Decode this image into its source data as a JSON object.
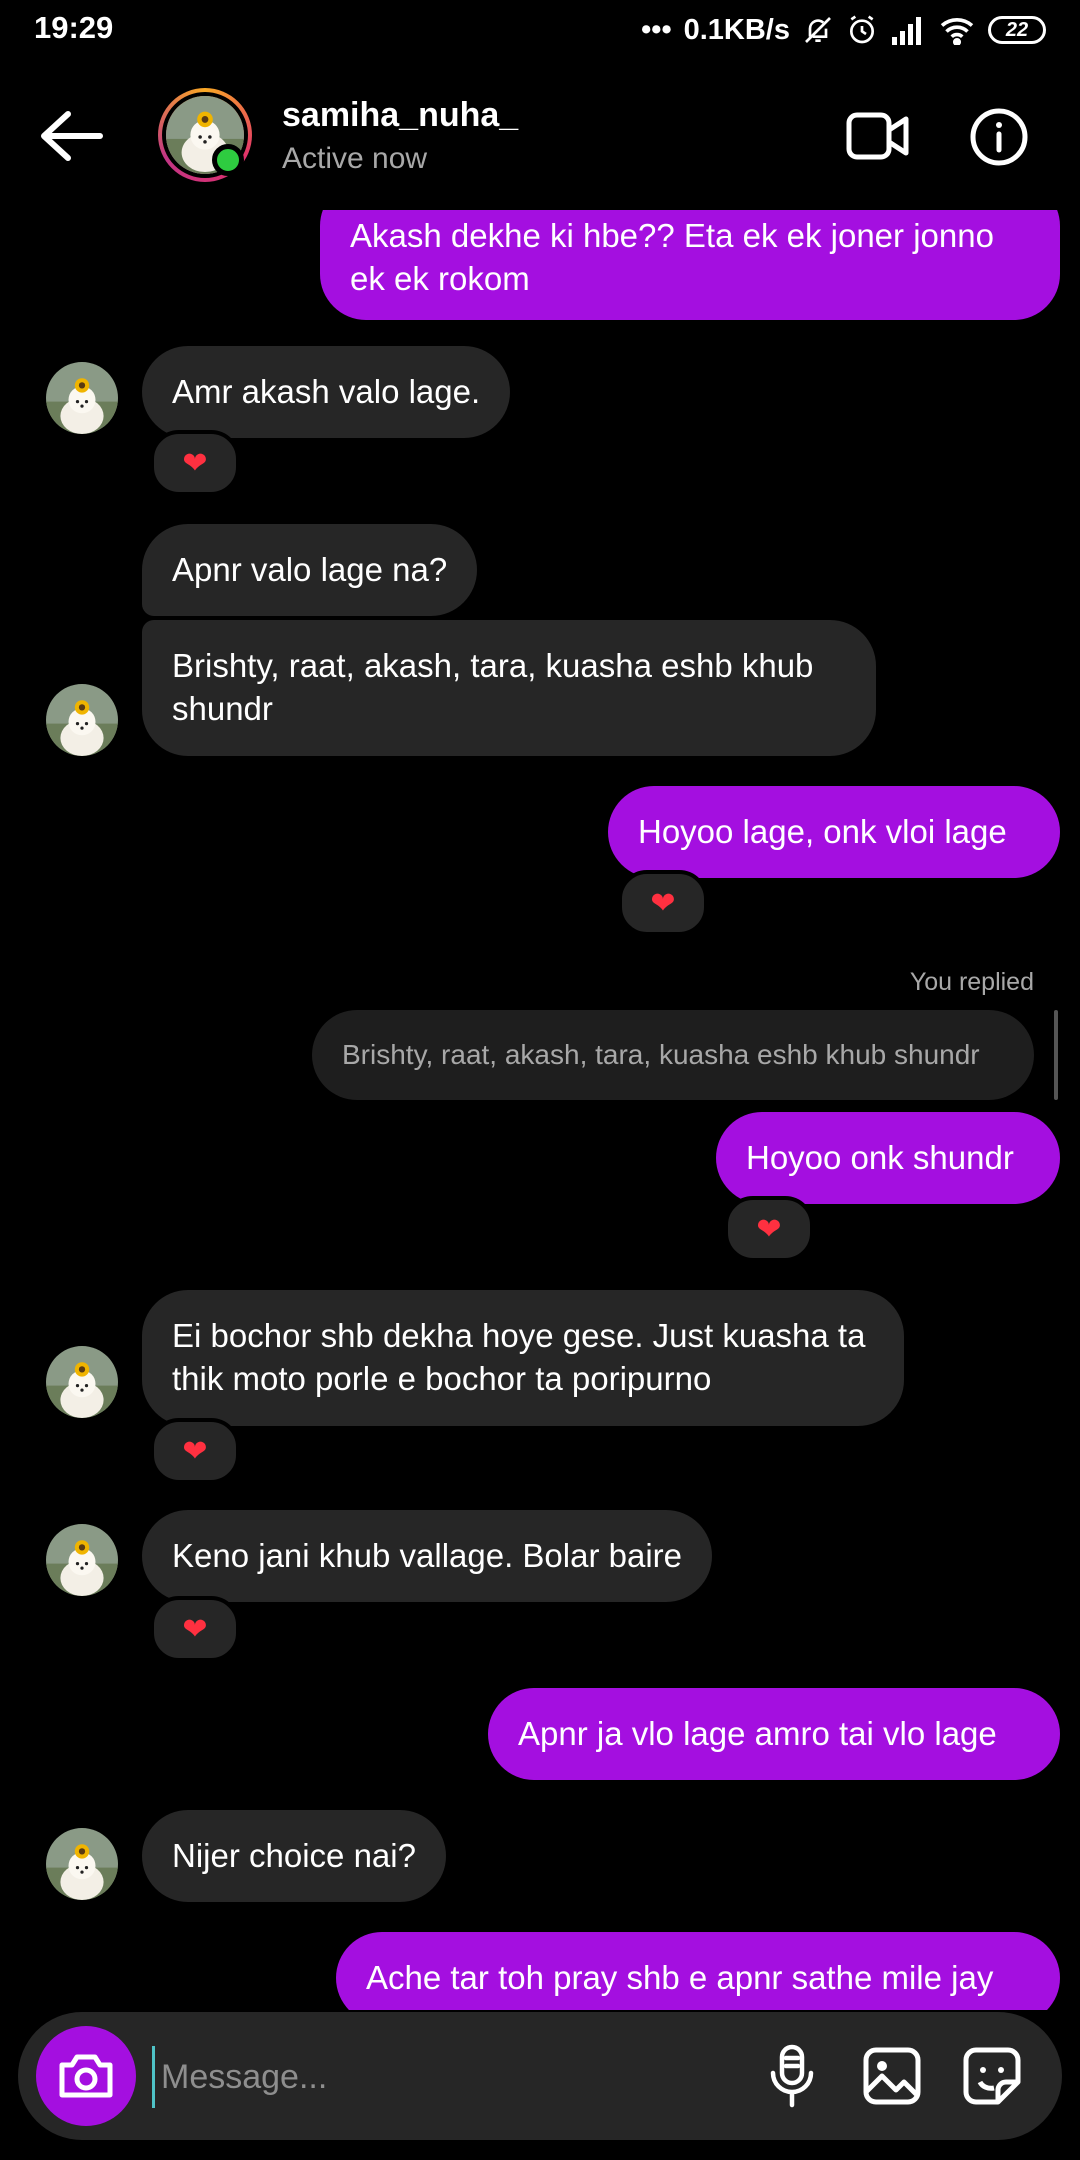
{
  "status_bar": {
    "time": "19:29",
    "network_speed": "0.1KB/s",
    "battery": "22"
  },
  "header": {
    "username": "samiha_nuha_",
    "status": "Active now"
  },
  "messages": [
    {
      "side": "out",
      "text": "Akash dekhe ki hbe?? Eta ek ek joner jonno ek ek rokom"
    },
    {
      "side": "in",
      "text": "Amr akash valo lage.",
      "reaction": "❤"
    },
    {
      "side": "in",
      "text": "Apnr valo lage na?"
    },
    {
      "side": "in",
      "text": "Brishty, raat, akash, tara, kuasha eshb khub shundr"
    },
    {
      "side": "out",
      "text": "Hoyoo lage, onk vloi lage",
      "reaction": "❤"
    },
    {
      "side": "out",
      "reply_label": "You replied",
      "quoted": "Brishty, raat, akash, tara, kuasha eshb khub shundr",
      "text": "Hoyoo onk shundr",
      "reaction": "❤"
    },
    {
      "side": "in",
      "text": "Ei bochor shb dekha hoye gese. Just kuasha ta thik moto porle e bochor ta poripurno",
      "reaction": "❤"
    },
    {
      "side": "in",
      "text": "Keno jani khub vallage. Bolar baire",
      "reaction": "❤"
    },
    {
      "side": "out",
      "text": "Apnr ja vlo lage amro tai vlo lage"
    },
    {
      "side": "in",
      "text": "Nijer choice nai?"
    },
    {
      "side": "out",
      "text": "Ache tar toh pray shb e apnr sathe mile jay"
    }
  ],
  "composer": {
    "placeholder": "Message..."
  },
  "colors": {
    "outgoing_bubble": "#a40fe0",
    "incoming_bubble": "#262626",
    "background": "#000000",
    "heart": "#ff3040",
    "online": "#2ecc40"
  },
  "icons": [
    "back-arrow-icon",
    "video-call-icon",
    "info-icon",
    "camera-icon",
    "microphone-icon",
    "gallery-icon",
    "sticker-icon",
    "heart-icon"
  ]
}
